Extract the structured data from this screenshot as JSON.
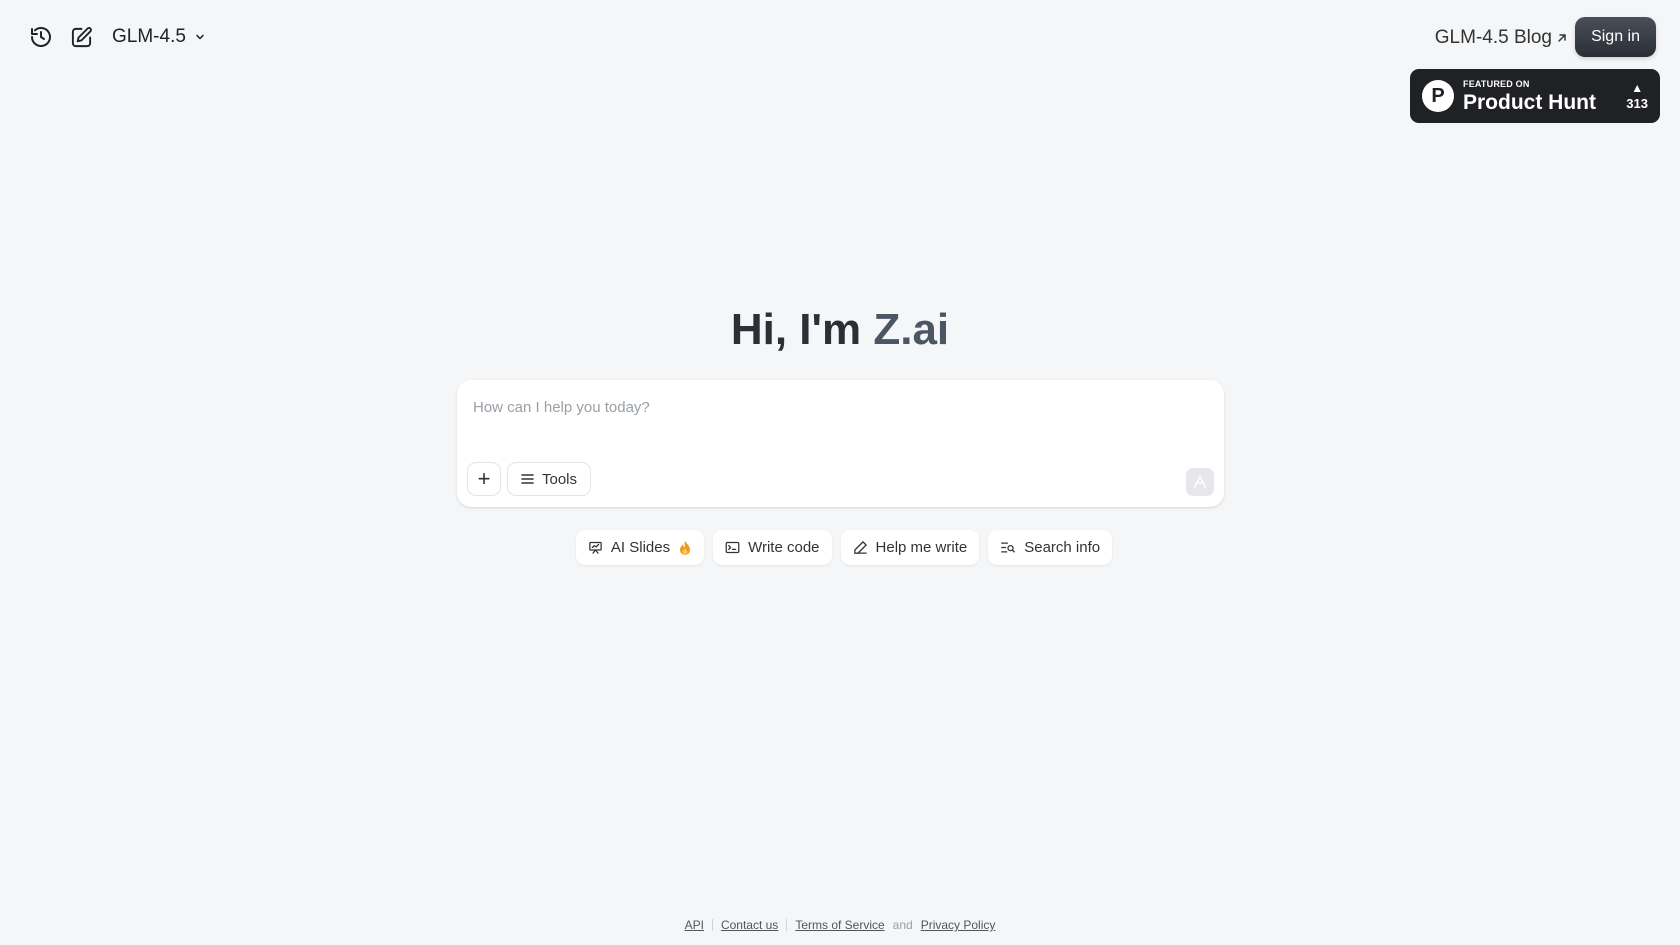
{
  "header": {
    "model_name": "GLM-4.5",
    "blog_link": "GLM-4.5 Blog",
    "sign_in": "Sign in"
  },
  "product_hunt": {
    "featured": "FEATURED ON",
    "name": "Product Hunt",
    "votes": "313"
  },
  "hero": {
    "title_prefix": "Hi, I'm ",
    "title_brand": "Z.ai"
  },
  "chat": {
    "placeholder": "How can I help you today?",
    "tools_label": "Tools"
  },
  "chips": {
    "ai_slides": "AI Slides",
    "write_code": "Write code",
    "help_me_write": "Help me write",
    "search_info": "Search info"
  },
  "footer": {
    "api": "API",
    "contact": "Contact us",
    "terms": "Terms of Service",
    "and": "and",
    "privacy": "Privacy Policy"
  },
  "colors": {
    "background": "#f4f6f8",
    "ph_badge": "#202124",
    "flame": "#f39c12"
  }
}
